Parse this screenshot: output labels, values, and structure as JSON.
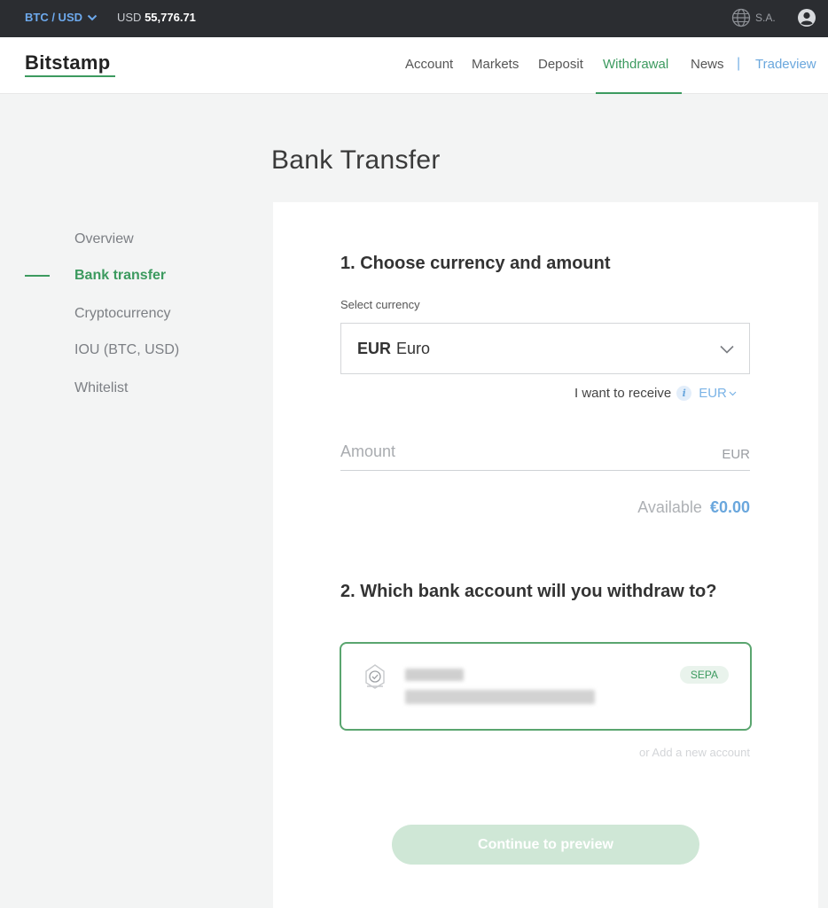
{
  "topbar": {
    "pair": "BTC / USD",
    "price_currency": "USD",
    "price_value": "55,776.71",
    "entity": "S.A."
  },
  "header": {
    "logo": "Bitstamp",
    "nav": [
      "Account",
      "Markets",
      "Deposit",
      "Withdrawal",
      "News"
    ],
    "active_nav": "Withdrawal",
    "tradeview": "Tradeview"
  },
  "page": {
    "title": "Bank Transfer"
  },
  "sidebar": {
    "items": [
      "Overview",
      "Bank transfer",
      "Cryptocurrency",
      "IOU (BTC, USD)",
      "Whitelist"
    ],
    "active": "Bank transfer"
  },
  "form": {
    "step1_title": "1. Choose currency and amount",
    "select_label": "Select currency",
    "currency_code": "EUR",
    "currency_name": "Euro",
    "receive_label": "I want to receive",
    "receive_currency": "EUR",
    "amount_placeholder": "Amount",
    "amount_unit": "EUR",
    "available_label": "Available",
    "available_value": "€0.00",
    "step2_title": "2. Which bank account will you withdraw to?",
    "account_badge": "SEPA",
    "add_account": "or Add a new account",
    "continue_label": "Continue to preview"
  },
  "colors": {
    "accent_green": "#3c9a5f",
    "link_blue": "#6aa7dd",
    "topbar_bg": "#2b2d31"
  }
}
